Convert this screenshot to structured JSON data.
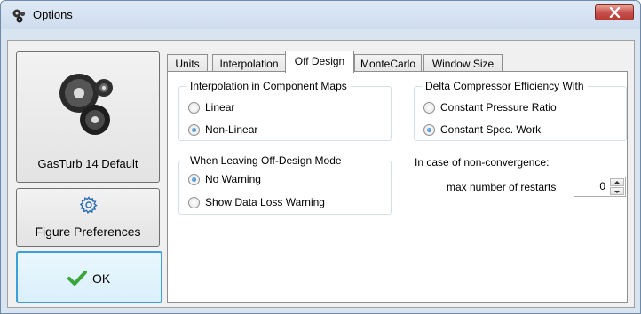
{
  "window": {
    "title": "Options",
    "icon": "app-gears-icon",
    "close_icon": "close-icon"
  },
  "sidebar": {
    "default_label": "GasTurb 14 Default",
    "default_icon": "engine-logo-icon",
    "figure_label": "Figure Preferences",
    "figure_icon": "gear-icon",
    "ok_label": "OK",
    "ok_icon": "checkmark-icon"
  },
  "tabs": [
    {
      "label": "Units",
      "active": false
    },
    {
      "label": "Interpolation",
      "active": false
    },
    {
      "label": "Off Design",
      "active": true
    },
    {
      "label": "MonteCarlo",
      "active": false
    },
    {
      "label": "Window Size",
      "active": false
    }
  ],
  "off_design": {
    "interp_group": {
      "title": "Interpolation in Component Maps",
      "options": [
        {
          "label": "Linear",
          "checked": false
        },
        {
          "label": "Non-Linear",
          "checked": true
        }
      ]
    },
    "leaving_group": {
      "title": "When Leaving Off-Design Mode",
      "options": [
        {
          "label": "No Warning",
          "checked": true
        },
        {
          "label": "Show Data Loss Warning",
          "checked": false
        }
      ]
    },
    "efficiency_group": {
      "title": "Delta Compressor Efficiency With",
      "options": [
        {
          "label": "Constant Pressure Ratio",
          "checked": false
        },
        {
          "label": "Constant Spec. Work",
          "checked": true
        }
      ]
    },
    "nonconvergence_label": "In case of non-convergence:",
    "restarts_label": "max number of restarts",
    "restarts_value": "0"
  },
  "colors": {
    "accent": "#3c9fd9",
    "check_green": "#3aa53a",
    "close_red": "#c75050"
  }
}
